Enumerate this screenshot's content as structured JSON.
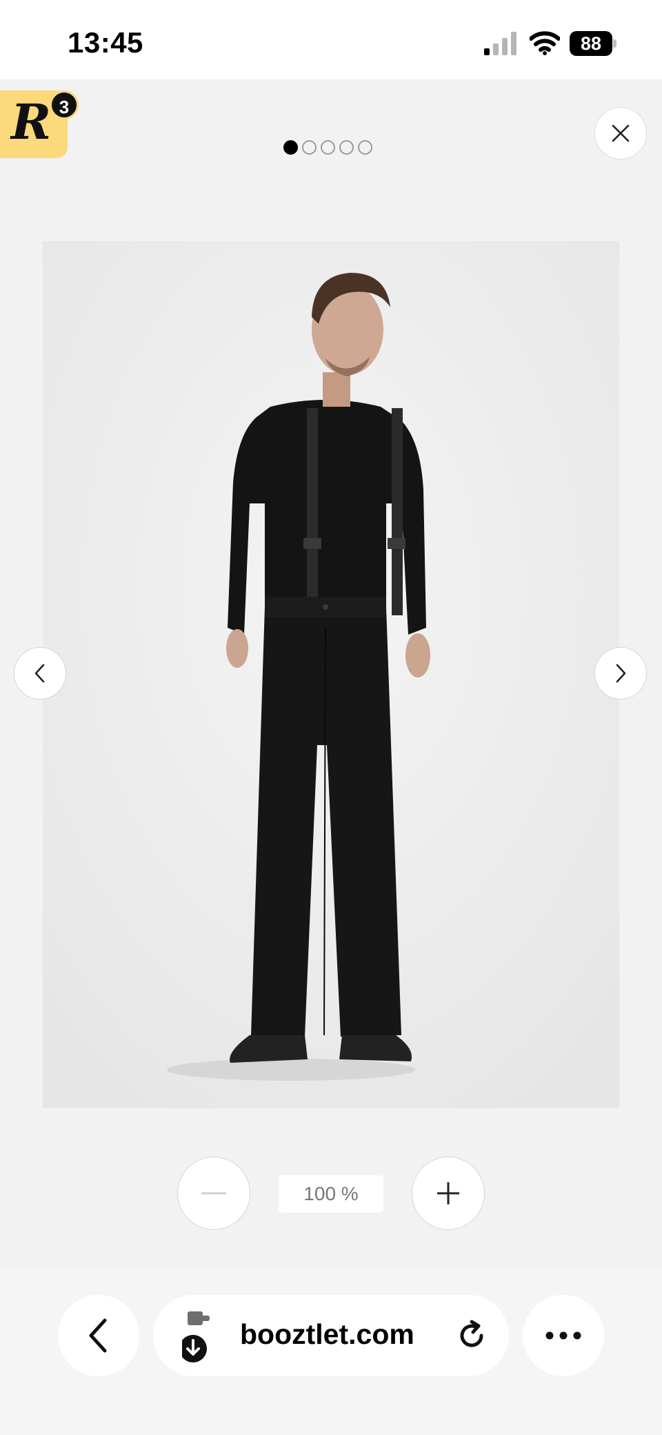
{
  "status_bar": {
    "time": "13:45",
    "battery_level": "88",
    "signal_bars_active": 1,
    "signal_bars_total": 4
  },
  "viewer": {
    "rakuten": {
      "letter": "R",
      "count": "3"
    },
    "pagination": {
      "total": 5,
      "active_index": 0
    },
    "product_image_alt": "",
    "zoom": {
      "level": "100 %"
    }
  },
  "browser": {
    "url": "booztlet.com"
  },
  "icons": {
    "close": "close-icon",
    "prev": "chevron-left-icon",
    "next": "chevron-right-icon",
    "zoom_out": "minus-icon",
    "zoom_in": "plus-icon",
    "back": "back-chevron-icon",
    "extension": "extension-download-icon",
    "reload": "reload-icon",
    "more": "more-dots-icon"
  },
  "colors": {
    "rakuten_badge": "#fcd97a",
    "viewer_bg": "#f2f2f2",
    "photo_bg": "#ebebeb",
    "garment": "#161616"
  }
}
